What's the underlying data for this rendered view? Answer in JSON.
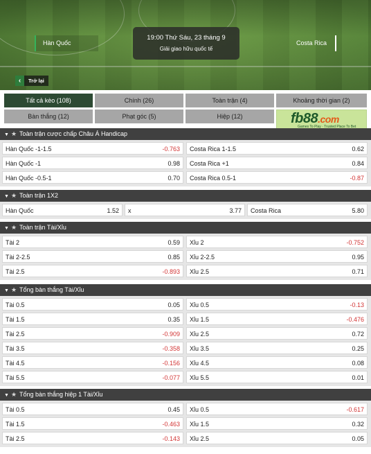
{
  "header": {
    "home_team": "Hàn Quốc",
    "away_team": "Costa Rica",
    "datetime": "19:00 Thứ Sáu, 23 tháng 9",
    "competition": "Giải giao hữu quốc tế",
    "back_label": "Trở lại"
  },
  "filters": [
    {
      "label": "Tất cả kèo (108)",
      "active": true
    },
    {
      "label": "Chính (26)",
      "active": false
    },
    {
      "label": "Toàn trận (4)",
      "active": false
    },
    {
      "label": "Khoảng thời gian (2)",
      "active": false
    },
    {
      "label": "Bàn thắng (12)",
      "active": false
    },
    {
      "label": "Phạt góc (5)",
      "active": false
    },
    {
      "label": "Hiệp (12)",
      "active": false
    }
  ],
  "banner": {
    "brand": "fb88",
    "domain": ".com",
    "tagline": "Games To Play · Trusted Place To Bet"
  },
  "sections": [
    {
      "title": "Toàn trận cược chấp Châu Á Handicap",
      "columns": 2,
      "rows": [
        [
          {
            "sel": "Hàn Quốc  -1-1.5",
            "odd": "-0.763"
          },
          {
            "sel": "Costa Rica  1-1.5",
            "odd": "0.62"
          }
        ],
        [
          {
            "sel": "Hàn Quốc  -1",
            "odd": "0.98"
          },
          {
            "sel": "Costa Rica  +1",
            "odd": "0.84"
          }
        ],
        [
          {
            "sel": "Hàn Quốc  -0.5-1",
            "odd": "0.70"
          },
          {
            "sel": "Costa Rica  0.5-1",
            "odd": "-0.87"
          }
        ]
      ]
    },
    {
      "title": "Toàn trận 1X2",
      "columns": 3,
      "rows": [
        [
          {
            "sel": "Hàn Quốc",
            "odd": "1.52"
          },
          {
            "sel": "x",
            "odd": "3.77"
          },
          {
            "sel": "Costa Rica",
            "odd": "5.80"
          }
        ]
      ]
    },
    {
      "title": "Toàn trận Tài/Xỉu",
      "columns": 2,
      "rows": [
        [
          {
            "sel": "Tài  2",
            "odd": "0.59"
          },
          {
            "sel": "Xỉu  2",
            "odd": "-0.752"
          }
        ],
        [
          {
            "sel": "Tài  2-2.5",
            "odd": "0.85"
          },
          {
            "sel": "Xỉu  2-2.5",
            "odd": "0.95"
          }
        ],
        [
          {
            "sel": "Tài  2.5",
            "odd": "-0.893"
          },
          {
            "sel": "Xỉu  2.5",
            "odd": "0.71"
          }
        ]
      ]
    },
    {
      "title": "Tổng bàn thắng Tài/Xỉu",
      "columns": 2,
      "rows": [
        [
          {
            "sel": "Tài  0.5",
            "odd": "0.05"
          },
          {
            "sel": "Xỉu  0.5",
            "odd": "-0.13"
          }
        ],
        [
          {
            "sel": "Tài  1.5",
            "odd": "0.35"
          },
          {
            "sel": "Xỉu  1.5",
            "odd": "-0.476"
          }
        ],
        [
          {
            "sel": "Tài  2.5",
            "odd": "-0.909"
          },
          {
            "sel": "Xỉu  2.5",
            "odd": "0.72"
          }
        ],
        [
          {
            "sel": "Tài  3.5",
            "odd": "-0.358"
          },
          {
            "sel": "Xỉu  3.5",
            "odd": "0.25"
          }
        ],
        [
          {
            "sel": "Tài  4.5",
            "odd": "-0.156"
          },
          {
            "sel": "Xỉu  4.5",
            "odd": "0.08"
          }
        ],
        [
          {
            "sel": "Tài  5.5",
            "odd": "-0.077"
          },
          {
            "sel": "Xỉu  5.5",
            "odd": "0.01"
          }
        ]
      ]
    },
    {
      "title": "Tổng bàn thắng hiệp 1 Tài/Xỉu",
      "columns": 2,
      "rows": [
        [
          {
            "sel": "Tài  0.5",
            "odd": "0.45"
          },
          {
            "sel": "Xỉu  0.5",
            "odd": "-0.617"
          }
        ],
        [
          {
            "sel": "Tài  1.5",
            "odd": "-0.463"
          },
          {
            "sel": "Xỉu  1.5",
            "odd": "0.32"
          }
        ],
        [
          {
            "sel": "Tài  2.5",
            "odd": "-0.143"
          },
          {
            "sel": "Xỉu  2.5",
            "odd": "0.05"
          }
        ]
      ]
    }
  ],
  "colors": {
    "negative_odd": "#d23535",
    "active_filter": "#2d4a33",
    "section_header": "#404040",
    "team_accent": "#35b35a"
  }
}
